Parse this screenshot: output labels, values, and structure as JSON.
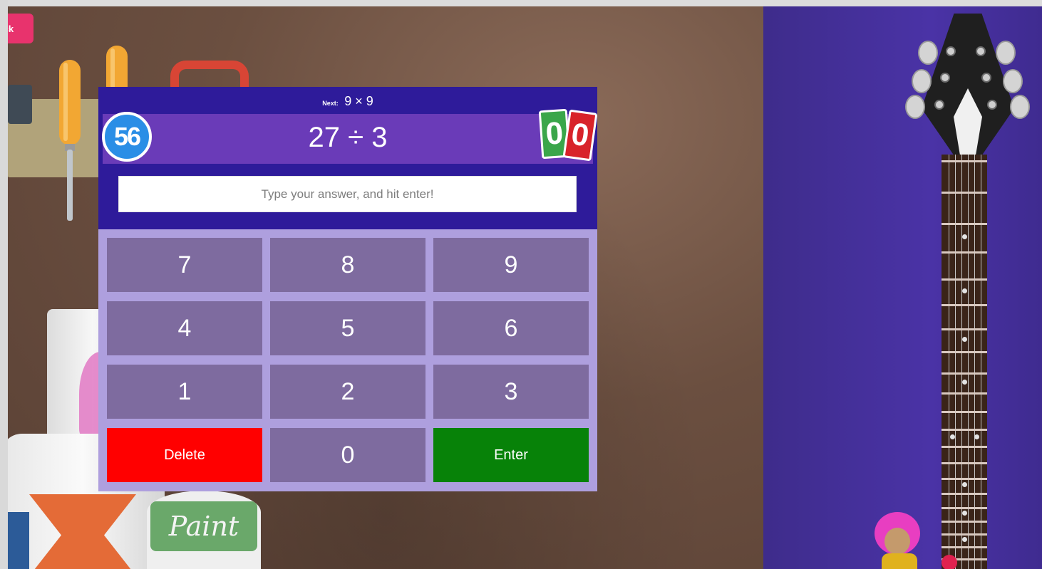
{
  "nav": {
    "back_label": "Back"
  },
  "quiz": {
    "next_label": "Next:",
    "next_question": "9 × 9",
    "question": "27 ÷ 3",
    "score": "56",
    "card_green": "0",
    "card_red": "0",
    "answer_value": "",
    "answer_placeholder": "Type your answer, and hit enter!"
  },
  "keypad": {
    "keys": [
      "7",
      "8",
      "9",
      "4",
      "5",
      "6",
      "1",
      "2",
      "3"
    ],
    "delete_label": "Delete",
    "zero_label": "0",
    "enter_label": "Enter"
  },
  "scene": {
    "paint_can_label": "Paint"
  },
  "colors": {
    "header_bg": "#2e1b9a",
    "question_band": "#6a3bb8",
    "keypad_bg": "#ae9fde",
    "key_bg": "#7e6b9f",
    "delete_bg": "#ff0000",
    "enter_bg": "#078208",
    "score_badge": "#2a8ee6",
    "back_button": "#e8336d",
    "stage_bg": "#45309b"
  }
}
